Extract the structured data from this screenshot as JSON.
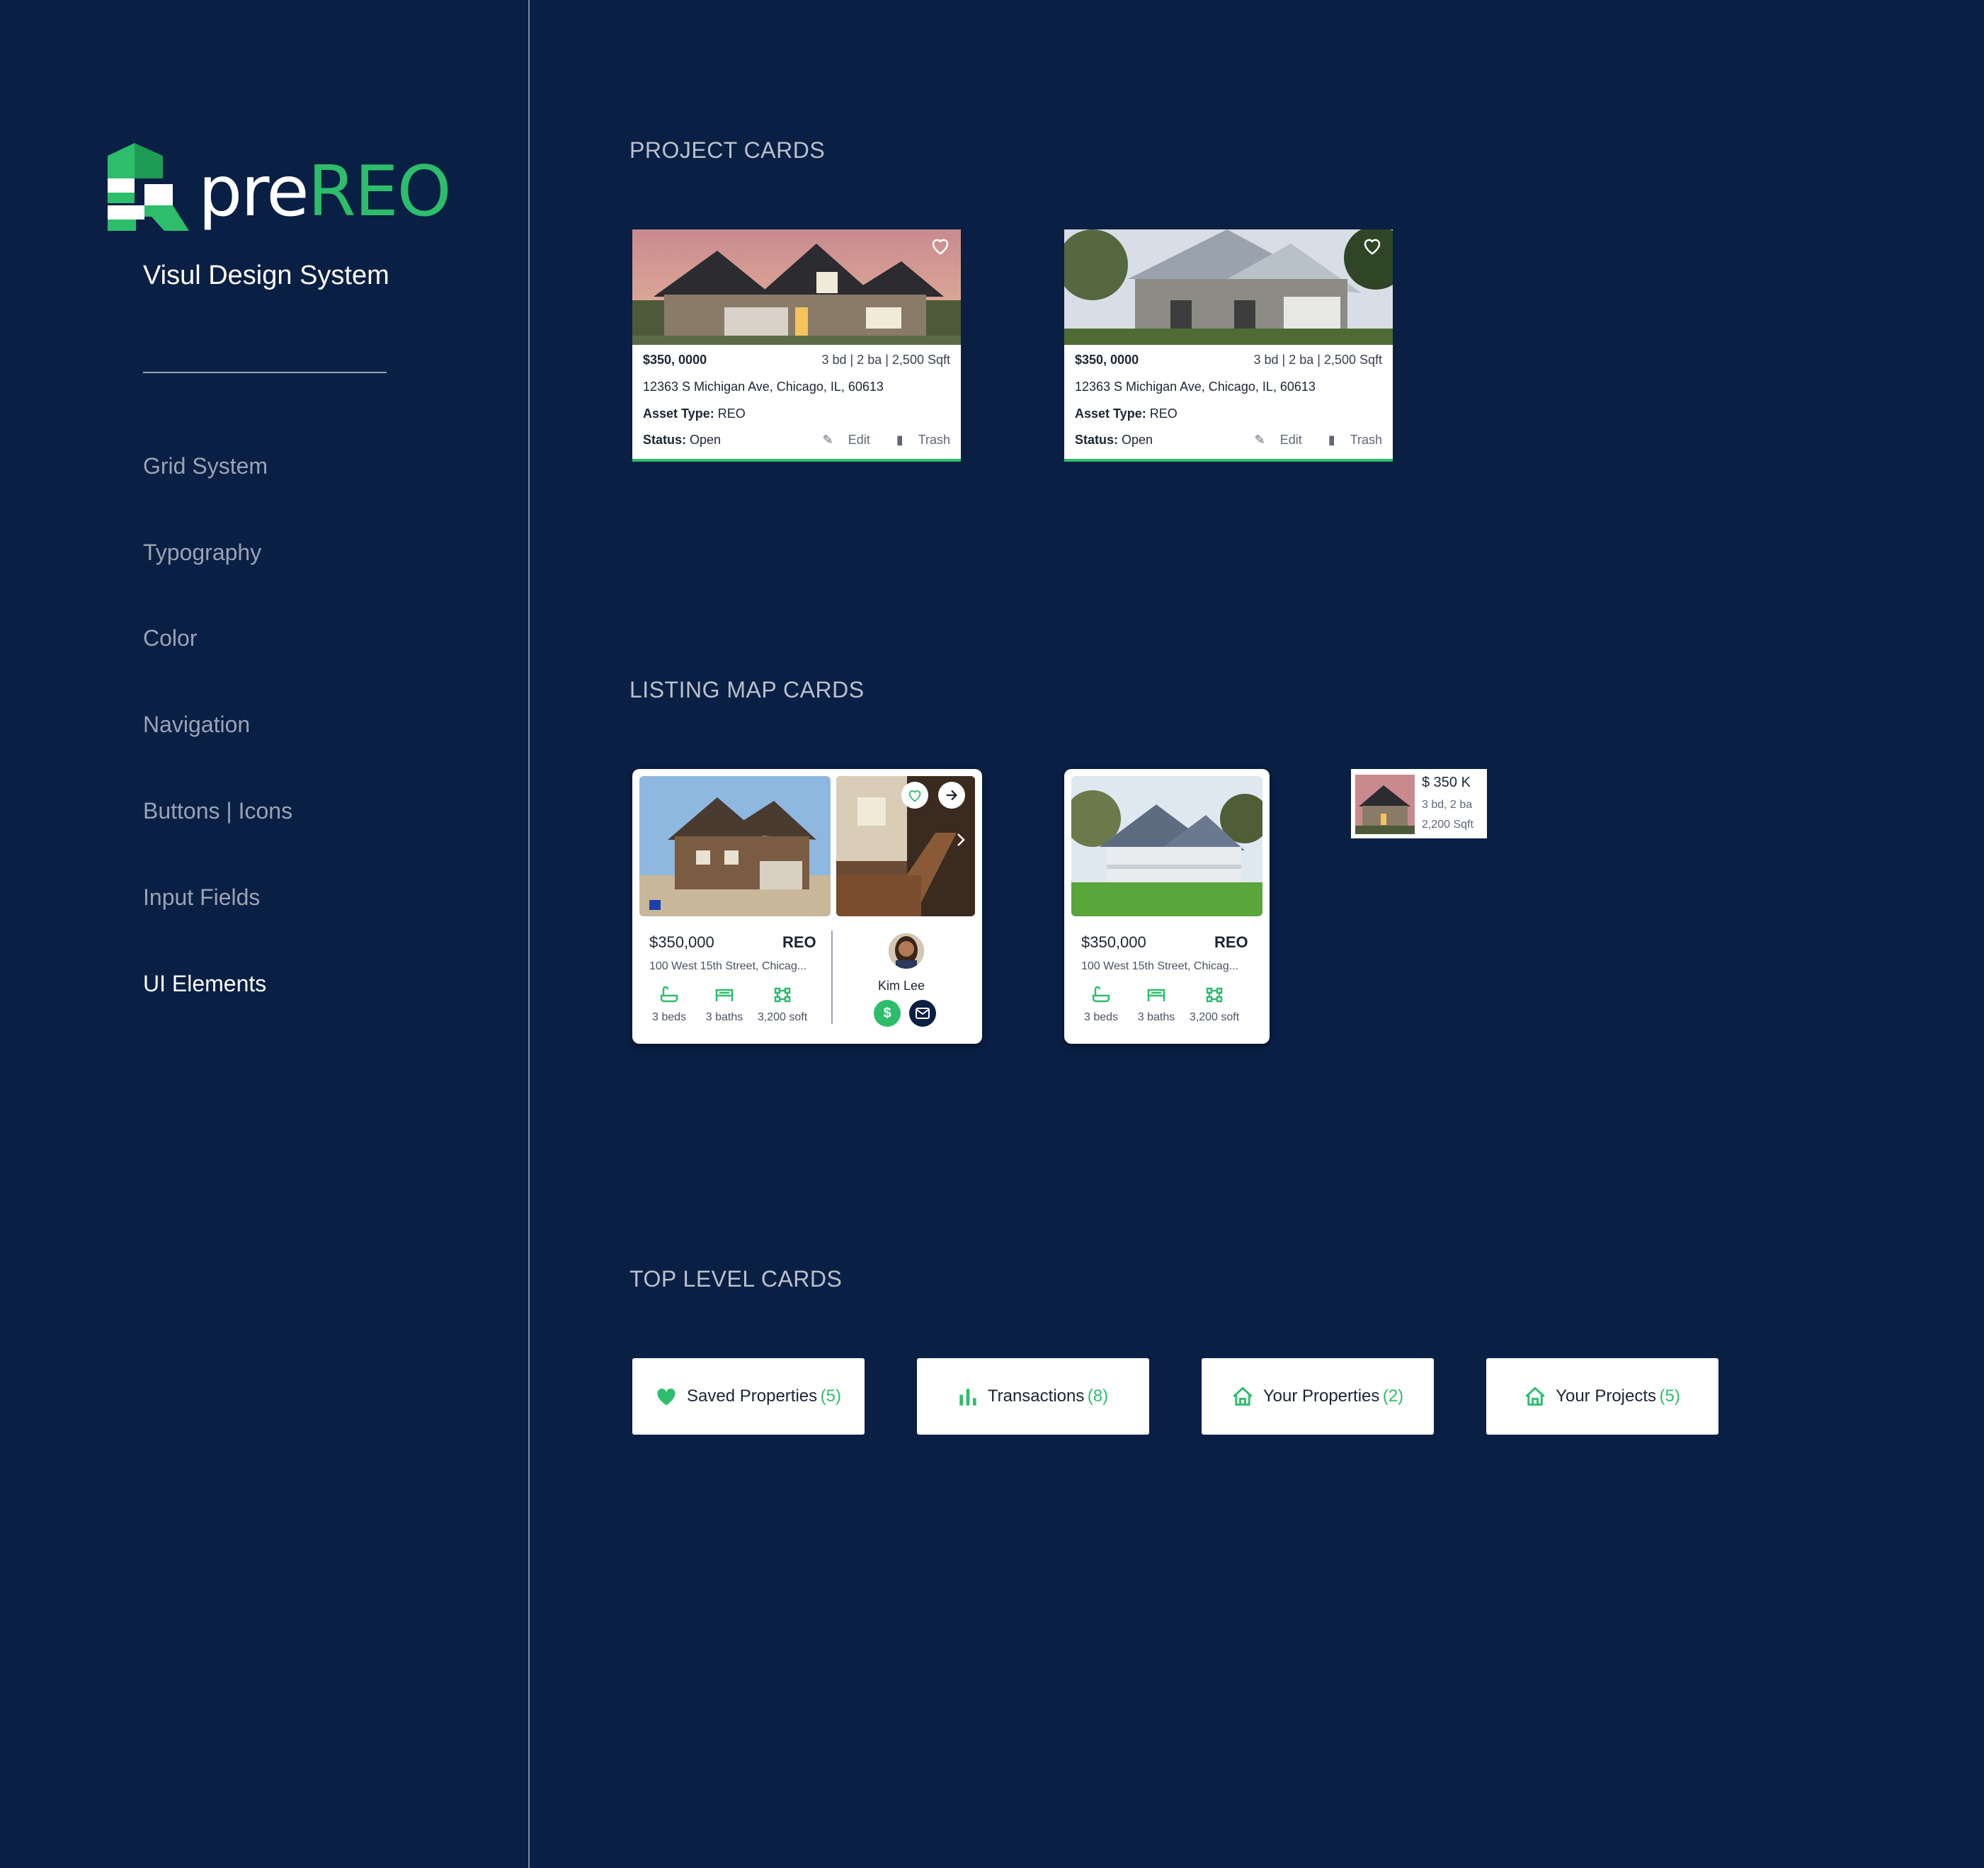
{
  "brand": {
    "logo_pre": "pre",
    "logo_reo": "REO",
    "subtitle": "Visul Design System"
  },
  "nav": [
    "Grid System",
    "Typography",
    "Color",
    "Navigation",
    "Buttons | Icons",
    "Input Fields",
    "UI Elements"
  ],
  "active_nav": "UI Elements",
  "sections": {
    "project_cards": "PROJECT CARDS",
    "listing_map_cards": "LISTING MAP CARDS",
    "top_level_cards": "TOP LEVEL CARDS"
  },
  "project_cards": [
    {
      "price": "$350, 0000",
      "specs": "3 bd | 2 ba | 2,500 Sqft",
      "address": "12363 S Michigan Ave, Chicago, IL, 60613",
      "asset_label": "Asset Type:",
      "asset_value": "REO",
      "status_label": "Status:",
      "status_value": "Open",
      "edit": "Edit",
      "trash": "Trash"
    },
    {
      "price": "$350, 0000",
      "specs": "3 bd | 2 ba | 2,500 Sqft",
      "address": "12363 S Michigan Ave, Chicago, IL, 60613",
      "asset_label": "Asset Type:",
      "asset_value": "REO",
      "status_label": "Status:",
      "status_value": "Open",
      "edit": "Edit",
      "trash": "Trash"
    }
  ],
  "listing_cards": [
    {
      "price": "$350,000",
      "type": "REO",
      "address": "100 West 15th Street, Chicag...",
      "beds": "3 beds",
      "baths": "3 baths",
      "area": "3,200 soft",
      "agent": "Kim Lee"
    },
    {
      "price": "$350,000",
      "type": "REO",
      "address": "100 West 15th Street, Chicag...",
      "beds": "3 beds",
      "baths": "3 baths",
      "area": "3,200 soft"
    }
  ],
  "mini_card": {
    "price": "$ 350 K",
    "specs": "3 bd, 2 ba",
    "area": "2,200 Sqft"
  },
  "top_cards": [
    {
      "label": "Saved Properties",
      "count": "(5)",
      "icon": "heart-icon"
    },
    {
      "label": "Transactions",
      "count": "(8)",
      "icon": "bar-chart-icon"
    },
    {
      "label": "Your Properties",
      "count": "(2)",
      "icon": "house-icon"
    },
    {
      "label": "Your Projects",
      "count": "(5)",
      "icon": "house-icon"
    }
  ],
  "colors": {
    "background": "#0a1f44",
    "accent": "#2dbd6b",
    "text_muted": "#9aa3b4",
    "card": "#ffffff"
  }
}
